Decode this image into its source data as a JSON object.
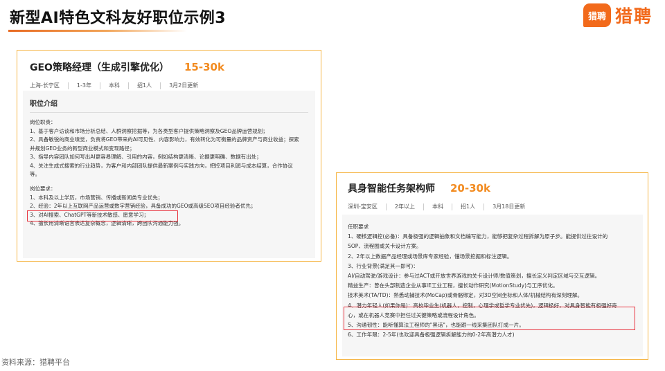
{
  "header": {
    "title": "新型AI特色文科友好职位示例3",
    "logo_badge": "猎聘",
    "logo_text": "猎聘"
  },
  "job1": {
    "title": "GEO策略经理（生成引擎优化）",
    "salary": "15-30k",
    "meta": [
      "上海-长宁区",
      "1-3年",
      "本科",
      "招1人",
      "3月2日更新"
    ],
    "section_title": "职位介绍",
    "duties_heading": "岗位职责：",
    "duties": [
      "1、基于客户访谈和市场分析总结、人群洞察挖掘等，为各类型客户提供策略洞察及GEO品牌运营规划；",
      "2、具备敏锐的商业嗅觉，负责将GEO带来的AI可见性、内容影响力，有效转化为可衡量的品牌资产与商业收益；探索",
      "并规划GEO业务的新型商业模式和变现路径；",
      "3、指导内容团队如何写出AI更容易理解、引用的内容，例如结构更清晰、论据更明确、数据有出处；",
      "4、关注生成式搜索的行业趋势，为客户和内部团队提供最新案例与实践方向，把控项目利润与成本结算，合作协议",
      "等。"
    ],
    "req_heading": "岗位要求：",
    "requirements": [
      "1、本科及以上学历，市场营销、传播或新闻类专业优先；",
      "2、经验：2年以上互联网产品运营或数字营销经验，具备成功的GEO或高级SEO项目经验者优先；",
      "3、对AI搜索、ChatGPT等新技术敏感、愿意学习；",
      "4、擅长用清晰语言表达复杂概念，逻辑清晰，跨团队沟通能力强。"
    ]
  },
  "job2": {
    "title": "具身智能任务架构师",
    "salary": "20-30k",
    "meta": [
      "深圳-宝安区",
      "2年以上",
      "本科",
      "招1人",
      "3月18日更新"
    ],
    "req_heading": "任职要求",
    "lines": [
      "1、硬核逻辑控(必备)：具备极强的逻辑抽象和文档编写能力，能够把复杂过程拆解为原子步。能提供过往设计的",
      "SOP、流程图或关卡设计方案。",
      "2、2年以上数据产品经理或场景库专家经验，懂场景挖掘和标注逻辑。",
      "3、行业背景(满足其一即可)：",
      "AI/自动驾驶/游戏设计：参与过ACT或开放世界游戏的关卡设计师/数值策划，擅长定义判定区域与交互逻辑。",
      "精益生产：曾在头部制造企业从事IE工业工程，擅长动作研究(MotionStudy)与工序优化。",
      "技术美术(TA/TD)：熟悉动捕技术(MoCap)或骨骼绑定，对3D空间坐标和人体/机械结构有深刻理解。",
      "4、潜力年轻人(如果你是)：高校毕业生(机器人，控制，心理学或哲学专业优先)，逻辑极好，对具身智能有极强好奇",
      "心，或在机器人竞赛中担任过关键策略或流程设计角色。",
      "5、沟通韧性：能听懂算法工程师的\"黑话\"，也能跟一线采集团队打成一片。",
      "6、工作年限：2-5年(也欢迎具备极强逻辑拆解能力的0-2年高潜力人才)"
    ]
  },
  "footer": {
    "source": "资料来源：猎聘平台"
  }
}
